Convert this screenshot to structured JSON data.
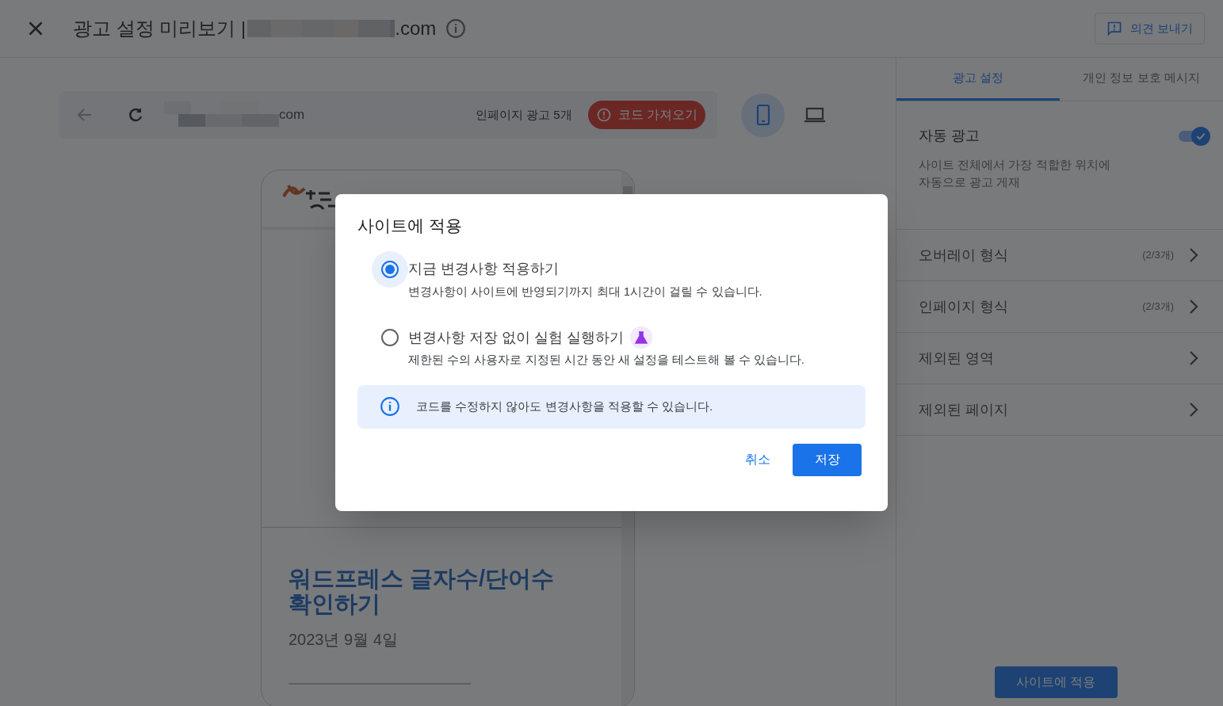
{
  "header": {
    "title": "광고 설정 미리보기 |",
    "domain_suffix": ".com",
    "feedback_button": "의견 보내기"
  },
  "toolbar": {
    "url_suffix": "com",
    "inpage_ads": "인페이지 광고 5개",
    "get_code_button": "코드 가져오기",
    "devices": [
      {
        "kind": "mobile",
        "selected": true
      },
      {
        "kind": "desktop",
        "selected": false
      }
    ]
  },
  "preview": {
    "post_title": "워드프레스 글자수/단어수 확인하기",
    "post_date": "2023년 9월 4일"
  },
  "panel": {
    "tabs": [
      {
        "label": "광고 설정",
        "selected": true
      },
      {
        "label": "개인 정보 보호 메시지",
        "selected": false
      }
    ],
    "auto_ads": {
      "title": "자동 광고",
      "description": "사이트 전체에서 가장 적합한 위치에 자동으로 광고 게재",
      "on": true
    },
    "rows": [
      {
        "label": "오버레이 형식",
        "count": "(2/3개)"
      },
      {
        "label": "인페이지 형식",
        "count": "(2/3개)"
      },
      {
        "label": "제외된 영역"
      },
      {
        "label": "제외된 페이지"
      }
    ],
    "apply_button": "사이트에 적용"
  },
  "dialog": {
    "title": "사이트에 적용",
    "options": [
      {
        "label": "지금 변경사항 적용하기",
        "description": "변경사항이 사이트에 반영되기까지 최대 1시간이 걸릴 수 있습니다.",
        "selected": true,
        "experimental": false
      },
      {
        "label": "변경사항 저장 없이 실험 실행하기",
        "description": "제한된 수의 사용자로 지정된 시간 동안 새 설정을 테스트해 볼 수 있습니다.",
        "selected": false,
        "experimental": true
      }
    ],
    "info": "코드를 수정하지 않아도 변경사항을 적용할 수 있습니다.",
    "cancel_button": "취소",
    "save_button": "저장"
  }
}
